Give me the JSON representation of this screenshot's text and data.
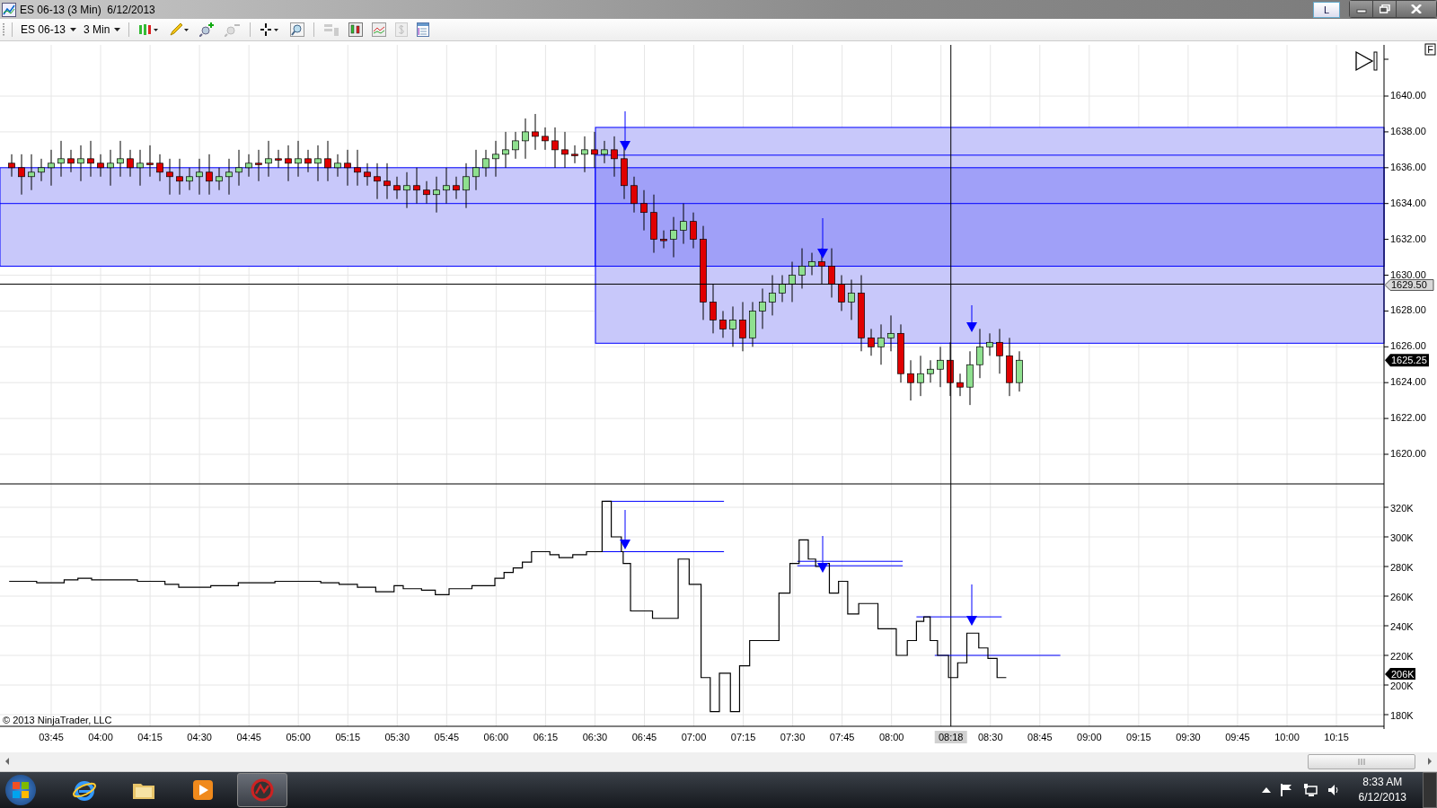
{
  "window": {
    "title": "ES 06-13 (3 Min)  6/12/2013",
    "link_button": "L"
  },
  "toolbar": {
    "instrument": "ES 06-13",
    "interval": "3 Min"
  },
  "price_panel": {
    "corner_button": "F",
    "y_ticks": [
      "1640.00",
      "1638.00",
      "1636.00",
      "1634.00",
      "1632.00",
      "1630.00",
      "1628.00",
      "1626.00",
      "1624.00",
      "1622.00",
      "1620.00"
    ],
    "crosshair_price": "1629.50",
    "last_price": "1625.25"
  },
  "indicator_panel": {
    "y_ticks": [
      "320K",
      "300K",
      "280K",
      "260K",
      "240K",
      "220K",
      "200K",
      "180K"
    ],
    "last_value": "206K",
    "copyright": "© 2013 NinjaTrader, LLC"
  },
  "time_axis": {
    "labels": [
      {
        "text": "03:45",
        "kind": "tick"
      },
      {
        "text": "04:00",
        "kind": "tick"
      },
      {
        "text": "04:15",
        "kind": "tick"
      },
      {
        "text": "04:30",
        "kind": "tick"
      },
      {
        "text": "04:45",
        "kind": "tick"
      },
      {
        "text": "05:00",
        "kind": "tick"
      },
      {
        "text": "05:15",
        "kind": "tick"
      },
      {
        "text": "05:30",
        "kind": "tick"
      },
      {
        "text": "05:45",
        "kind": "tick"
      },
      {
        "text": "06:00",
        "kind": "tick"
      },
      {
        "text": "06:15",
        "kind": "tick"
      },
      {
        "text": "06:30",
        "kind": "tick"
      },
      {
        "text": "06:45",
        "kind": "tick"
      },
      {
        "text": "07:00",
        "kind": "tick"
      },
      {
        "text": "07:15",
        "kind": "tick"
      },
      {
        "text": "07:30",
        "kind": "tick"
      },
      {
        "text": "07:45",
        "kind": "tick"
      },
      {
        "text": "08:00",
        "kind": "tick"
      },
      {
        "text": "08:18",
        "kind": "crosshair"
      },
      {
        "text": "08:30",
        "kind": "tick"
      },
      {
        "text": "08:45",
        "kind": "tick"
      },
      {
        "text": "09:00",
        "kind": "tick"
      },
      {
        "text": "09:15",
        "kind": "tick"
      },
      {
        "text": "09:30",
        "kind": "tick"
      },
      {
        "text": "09:45",
        "kind": "tick"
      },
      {
        "text": "10:00",
        "kind": "tick"
      },
      {
        "text": "10:15",
        "kind": "tick"
      }
    ]
  },
  "taskbar": {
    "apps": [
      {
        "kind": "browser",
        "selected": false
      },
      {
        "kind": "folder",
        "selected": false
      },
      {
        "kind": "media",
        "selected": false
      },
      {
        "kind": "trading",
        "selected": true
      }
    ],
    "time": "8:33 AM",
    "date": "6/12/2013"
  }
}
